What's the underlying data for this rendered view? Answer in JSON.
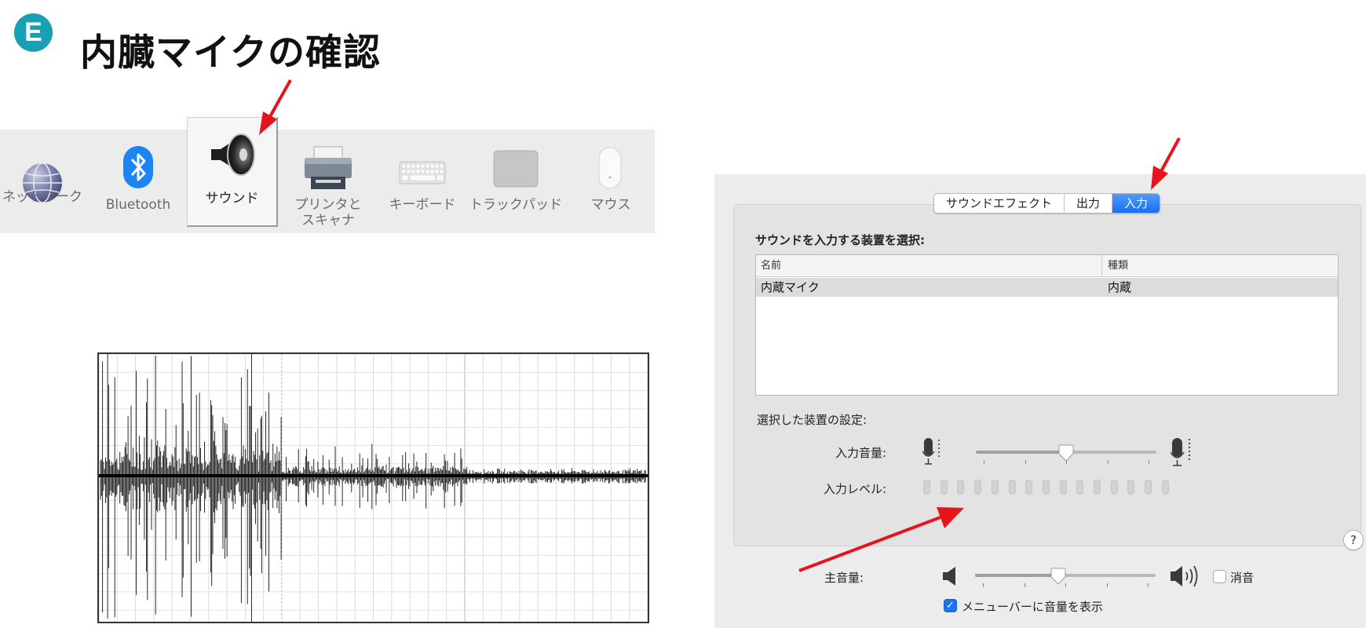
{
  "header": {
    "badge_letter": "E",
    "title": "内臓マイクの確認"
  },
  "toolbar": {
    "items": [
      {
        "label": "ネットワーク",
        "icon": "network-globe-icon"
      },
      {
        "label": "Bluetooth",
        "icon": "bluetooth-icon"
      },
      {
        "label": "サウンド",
        "icon": "speaker-icon",
        "selected": true
      },
      {
        "label_line1": "プリンタと",
        "label_line2": "スキャナ",
        "icon": "printer-icon"
      },
      {
        "label": "キーボード",
        "icon": "keyboard-icon"
      },
      {
        "label": "トラックパッド",
        "icon": "trackpad-icon"
      },
      {
        "label": "マウス",
        "icon": "mouse-icon"
      }
    ]
  },
  "sound_pane": {
    "tabs": [
      {
        "label": "サウンドエフェクト",
        "active": false
      },
      {
        "label": "出力",
        "active": false
      },
      {
        "label": "入力",
        "active": true
      }
    ],
    "select_title": "サウンドを入力する装置を選択:",
    "table": {
      "headers": [
        "名前",
        "種類"
      ],
      "rows": [
        [
          "内蔵マイク",
          "内蔵"
        ]
      ]
    },
    "device_settings_label": "選択した装置の設定:",
    "input_volume_label": "入力音量:",
    "input_volume": 0.5,
    "input_level_label": "入力レベル:",
    "input_level_lit": 0,
    "input_level_cells": 15,
    "help_label": "?",
    "output_volume_label": "主音量:",
    "output_volume": 0.46,
    "mute_label": "消音",
    "mute_checked": false,
    "menubar_label": "メニューバーに音量を表示",
    "menubar_checked": true
  },
  "colors": {
    "badge": "#1aa0b4",
    "accent_blue": "#1a73f0",
    "annotation_red": "#e8141b"
  }
}
